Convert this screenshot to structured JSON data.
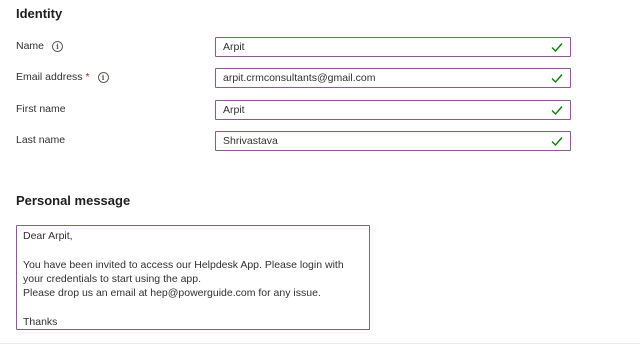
{
  "identity": {
    "heading": "Identity",
    "fields": [
      {
        "label": "Name",
        "required": false,
        "info": true,
        "value": "Arpit"
      },
      {
        "label": "Email address",
        "required": true,
        "info": true,
        "value": "arpit.crmconsultants@gmail.com"
      },
      {
        "label": "First name",
        "required": false,
        "info": false,
        "value": "Arpit"
      },
      {
        "label": "Last name",
        "required": false,
        "info": false,
        "value": "Shrivastava"
      }
    ],
    "required_marker": "*",
    "info_glyph": "i",
    "valid_icon": "checkmark-icon"
  },
  "personal_message": {
    "heading": "Personal message",
    "text": "Dear Arpit,\n\nYou have been invited to access our Helpdesk App. Please login with your credentials to start using the app.\nPlease drop us an email at hep@powerguide.com for any issue.\n\nThanks"
  },
  "colors": {
    "field_border": "#8a5b92",
    "check": "#107c10",
    "required": "#a4262c"
  }
}
